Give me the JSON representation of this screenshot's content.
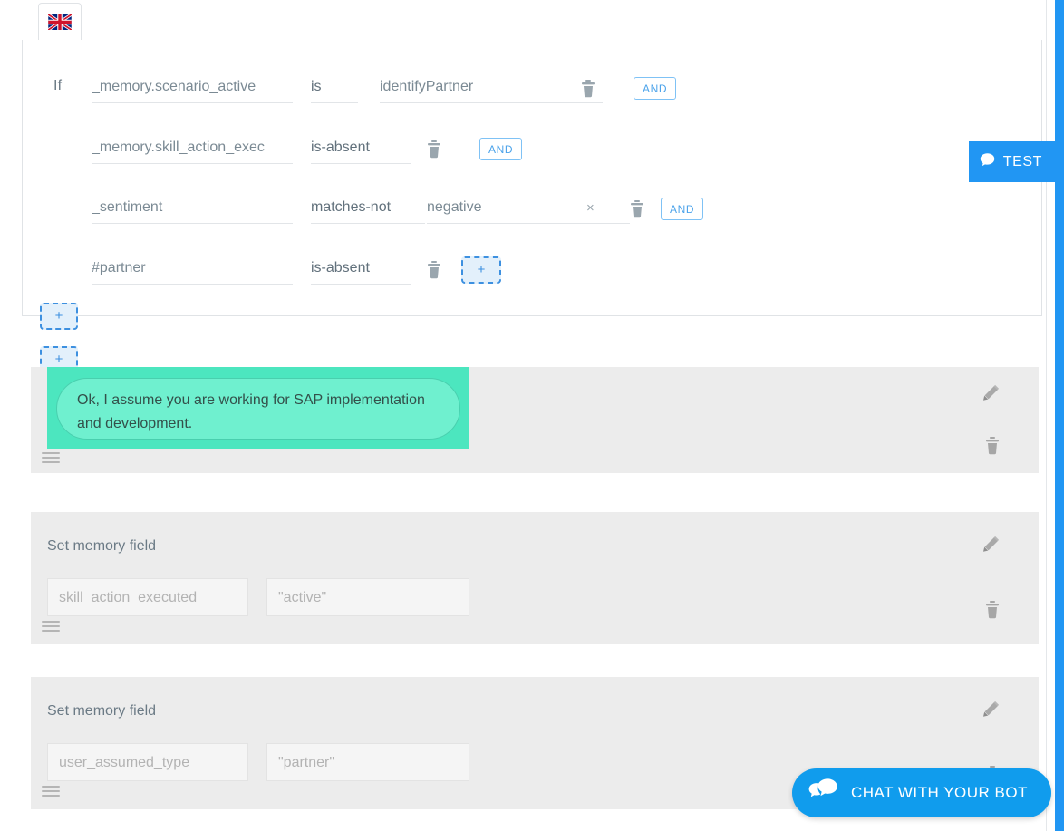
{
  "tab": {
    "flag_icon": "uk-flag-icon",
    "label": ""
  },
  "conditions": {
    "if_label": "If",
    "rows": [
      {
        "field": "_memory.scenario_active",
        "operator": "is",
        "value": "identifyPartner",
        "has_value": true,
        "has_clear": false,
        "delete_icon": "trash-icon",
        "connector": "AND",
        "connector_type": "and"
      },
      {
        "field": "_memory.skill_action_exec",
        "operator": "is-absent",
        "value": "",
        "has_value": false,
        "has_clear": false,
        "delete_icon": "trash-icon",
        "connector": "AND",
        "connector_type": "and"
      },
      {
        "field": "_sentiment",
        "operator": "matches-not",
        "value": "negative",
        "has_value": true,
        "has_clear": true,
        "clear_label": "×",
        "delete_icon": "trash-icon",
        "connector": "AND",
        "connector_type": "and"
      },
      {
        "field": "#partner",
        "operator": "is-absent",
        "value": "",
        "has_value": false,
        "has_clear": false,
        "delete_icon": "trash-icon",
        "connector": "+",
        "connector_type": "plus"
      }
    ],
    "add_condition_group_label": "+",
    "add_action_label": "+"
  },
  "actions": [
    {
      "type": "message",
      "bubble_text": "Ok, I assume you are working for SAP implementation and development.",
      "edit_icon": "pencil-icon",
      "delete_icon": "trash-icon",
      "drag_icon": "drag-handle-icon"
    },
    {
      "type": "memory",
      "title": "Set memory field",
      "key_value": "skill_action_executed",
      "val_value": "\"active\"",
      "edit_icon": "pencil-icon",
      "delete_icon": "trash-icon",
      "drag_icon": "drag-handle-icon"
    },
    {
      "type": "memory",
      "title": "Set memory field",
      "key_value": "user_assumed_type",
      "val_value": "\"partner\"",
      "edit_icon": "pencil-icon",
      "delete_icon": "trash-icon",
      "drag_icon": "drag-handle-icon"
    }
  ],
  "test_button": {
    "label": "TEST",
    "icon": "chat-bubble-icon"
  },
  "chat_widget": {
    "label": "CHAT WITH YOUR BOT",
    "icon": "chat-bubbles-icon"
  },
  "colors": {
    "accent_blue": "#2196f3",
    "chat_blue": "#109ced",
    "bubble_green": "#4ce6bf",
    "bubble_inner_green": "#6ff0cf",
    "card_gray": "#ececec"
  }
}
